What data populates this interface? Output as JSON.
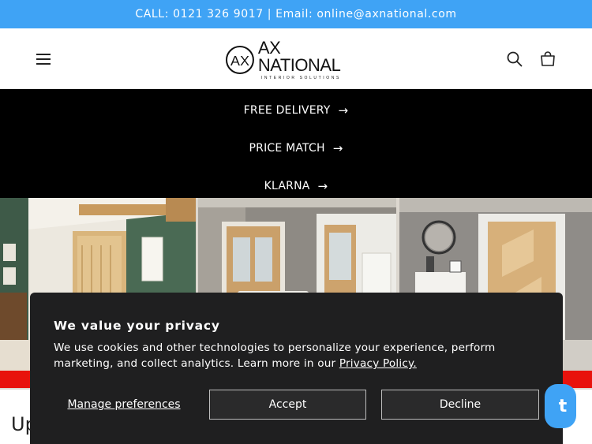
{
  "announcement": {
    "text": "CALL: 0121 326 9017 | Email: online@axnational.com"
  },
  "header": {
    "logo_name": "AX NATIONAL",
    "logo_tagline": "INTERIOR SOLUTIONS",
    "logo_mark": "AX",
    "icons": [
      "menu-icon",
      "search-icon",
      "cart-icon"
    ]
  },
  "promo": {
    "items": [
      {
        "label": "FREE DELIVERY",
        "arrow": "→"
      },
      {
        "label": "PRICE MATCH",
        "arrow": "→"
      },
      {
        "label": "KLARNA",
        "arrow": "→"
      }
    ]
  },
  "page": {
    "heading_partial": "Up"
  },
  "cookie_banner": {
    "title": "We value your privacy",
    "body": "We use cookies and other technologies to personalize your experience, perform marketing, and collect analytics. Learn more in our ",
    "link_text": "Privacy Policy.",
    "manage_label": "Manage preferences",
    "accept_label": "Accept",
    "decline_label": "Decline"
  },
  "chat": {
    "label": "t"
  },
  "colors": {
    "announcement_bg": "#3fa3f5",
    "promo_bg": "#000000",
    "cookie_bg": "#1f1f20",
    "red_band": "#e8120c"
  }
}
